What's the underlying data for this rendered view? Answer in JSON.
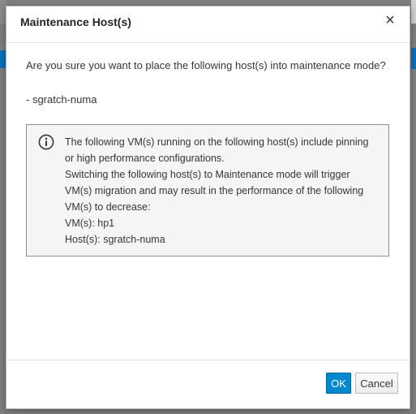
{
  "dialog": {
    "title": "Maintenance Host(s)",
    "close_icon": "close-icon",
    "question": "Are you sure you want to place the following host(s) into maintenance mode?",
    "hosts": [
      "- sgratch-numa"
    ],
    "alert": {
      "icon": "info-icon",
      "lines": [
        "The following VM(s) running on the following host(s) include pinning",
        "or high performance configurations.",
        "Switching the following host(s) to Maintenance mode will trigger",
        "VM(s) migration and may result in the performance of the following",
        "VM(s) to decrease:",
        "VM(s): hp1",
        "Host(s): sgratch-numa"
      ]
    },
    "buttons": {
      "ok_label": "OK",
      "cancel_label": "Cancel"
    }
  },
  "colors": {
    "primary_button": "#0088ce",
    "alert_background": "#f5f5f5",
    "background_accent": "#0b6fb8"
  }
}
